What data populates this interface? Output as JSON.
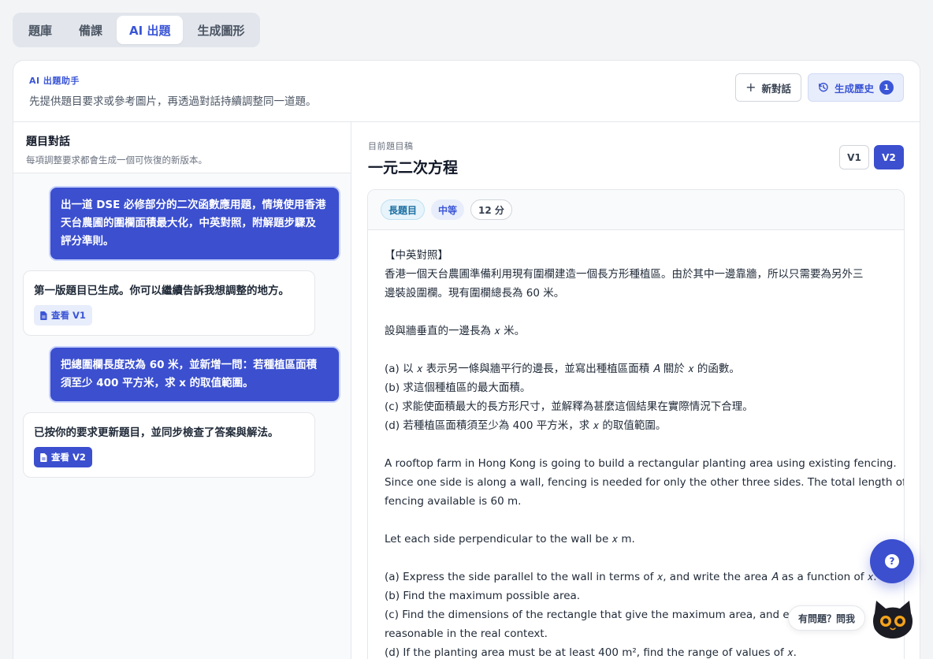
{
  "tabs": [
    {
      "label": "題庫"
    },
    {
      "label": "備課"
    },
    {
      "label": "AI 出題"
    },
    {
      "label": "生成圖形"
    }
  ],
  "header": {
    "label": "AI 出題助手",
    "description": "先提供題目要求或參考圖片，再透過對話持續調整同一道題。",
    "new_chat": "新對話",
    "history": "生成歷史",
    "history_count": "1"
  },
  "chat": {
    "title": "題目對話",
    "subtitle": "每項調整要求都會生成一個可恢復的新版本。",
    "messages": [
      {
        "role": "user",
        "lines": [
          "出一道 DSE 必修部分的二次函數應用題，情境使用香港",
          "天台農圃的圍欄面積最大化，中英對照，附解題步驟及",
          "評分準則。"
        ]
      },
      {
        "role": "assistant",
        "text": "第一版題目已生成。你可以繼續告訴我想調整的地方。",
        "link": "查看 V1"
      },
      {
        "role": "user",
        "lines": [
          "把總圍欄長度改為 60 米，並新增一問：若種植區面積",
          "須至少 400 平方米，求 x 的取值範圍。"
        ]
      },
      {
        "role": "assistant",
        "text": "已按你的要求更新題目，並同步檢查了答案與解法。",
        "link": "查看 V2"
      }
    ]
  },
  "draft": {
    "label": "目前題目稿",
    "title": "一元二次方程",
    "versions": [
      "V1",
      "V2"
    ],
    "tags": {
      "type": "長題目",
      "difficulty": "中等",
      "marks": "12 分"
    },
    "lines": [
      "【中英對照】",
      "香港一個天台農圃準備利用現有圍欄建造一個長方形種植區。由於其中一邊靠牆，所以只需要為另外三",
      "邊裝設圍欄。現有圍欄總長為 60 米。",
      "",
      "設與牆垂直的一邊長為 𝑥 米。",
      "",
      "(a) 以 𝑥 表示另一條與牆平行的邊長，並寫出種植區面積 𝐴 關於 𝑥 的函數。",
      "(b) 求這個種植區的最大面積。",
      "(c) 求能使面積最大的長方形尺寸，並解釋為甚麼這個結果在實際情況下合理。",
      "(d) 若種植區面積須至少為 400 平方米，求 𝑥 的取值範圍。",
      "",
      "A rooftop farm in Hong Kong is going to build a rectangular planting area using existing fencing.",
      "Since one side is along a wall, fencing is needed for only the other three sides. The total length of",
      "fencing available is 60 m.",
      "",
      "Let each side perpendicular to the wall be 𝑥 m.",
      "",
      "(a) Express the side parallel to the wall in terms of 𝑥, and write the area 𝐴 as a function of 𝑥.",
      "(b) Find the maximum possible area.",
      "(c) Find the dimensions of the rectangle that give the maximum area, and explai",
      "reasonable in the real context.",
      "(d) If the planting area must be at least 400 m², find the range of values of 𝑥."
    ]
  },
  "help": {
    "ask_label": "有問題？問我",
    "button_glyph": "?"
  }
}
